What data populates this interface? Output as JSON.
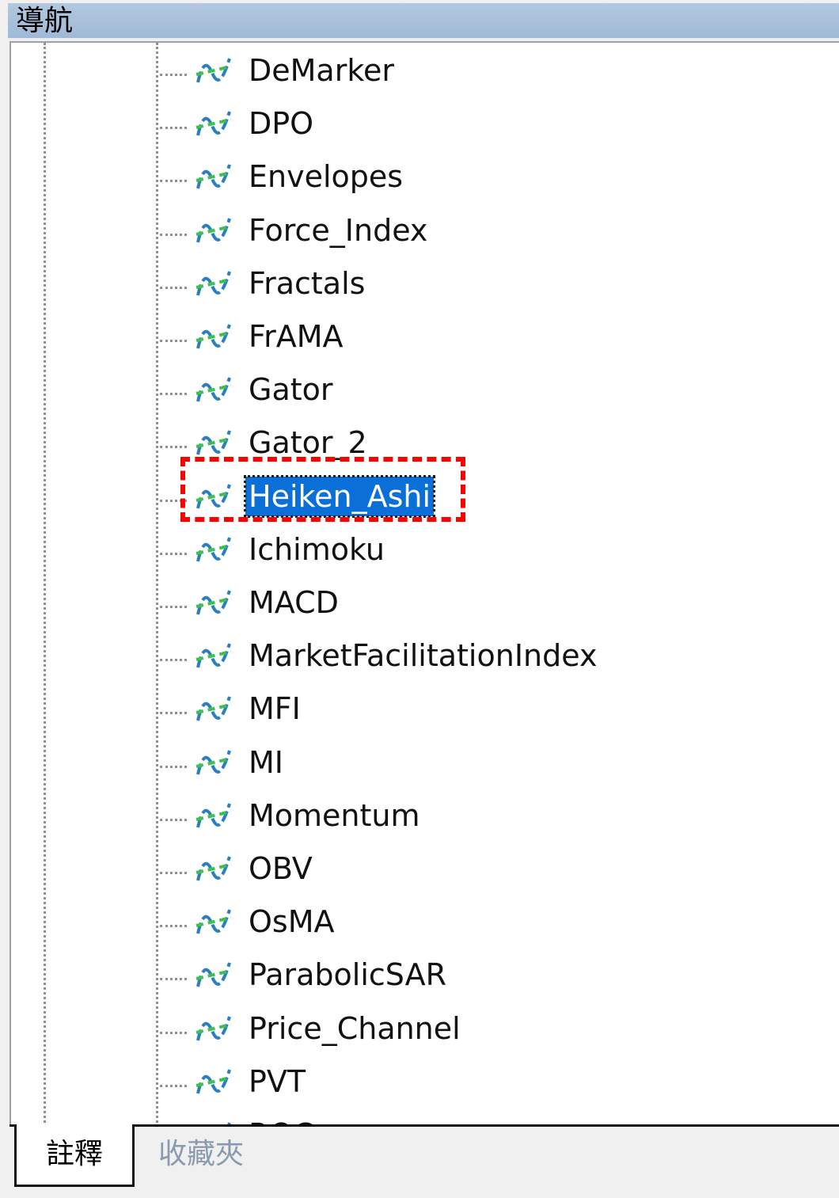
{
  "panel": {
    "title": "導航"
  },
  "tree": {
    "items": [
      {
        "label": "DeMarker"
      },
      {
        "label": "DPO"
      },
      {
        "label": "Envelopes"
      },
      {
        "label": "Force_Index"
      },
      {
        "label": "Fractals"
      },
      {
        "label": "FrAMA"
      },
      {
        "label": "Gator"
      },
      {
        "label": "Gator_2"
      },
      {
        "label": "Heiken_Ashi",
        "selected": true
      },
      {
        "label": "Ichimoku"
      },
      {
        "label": "MACD"
      },
      {
        "label": "MarketFacilitationIndex"
      },
      {
        "label": "MFI"
      },
      {
        "label": "MI"
      },
      {
        "label": "Momentum"
      },
      {
        "label": "OBV"
      },
      {
        "label": "OsMA"
      },
      {
        "label": "ParabolicSAR"
      },
      {
        "label": "Price_Channel"
      },
      {
        "label": "PVT"
      },
      {
        "label": "ROC"
      }
    ],
    "icon": "indicator-wave-icon",
    "selection_color": "#0a6fd6",
    "highlight_color": "#ff0000"
  },
  "tabs": [
    {
      "label": "註釋",
      "active": true
    },
    {
      "label": "收藏夾",
      "active": false
    }
  ]
}
